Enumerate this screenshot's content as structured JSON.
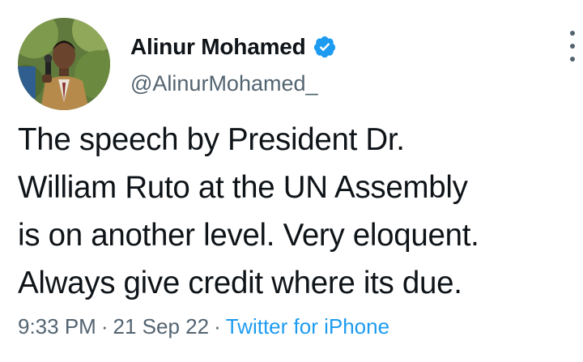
{
  "author": {
    "display_name": "Alinur Mohamed",
    "handle": "@AlinurMohamed_",
    "verified": true,
    "avatar_icon": "profile-photo"
  },
  "tweet": {
    "text_lines": [
      "The speech by President Dr.",
      "William Ruto at the UN Assembly",
      "is on another level. Very eloquent.",
      "Always give credit where its due."
    ]
  },
  "meta": {
    "time": "9:33 PM",
    "separator": "·",
    "date": "21 Sep 22",
    "source": "Twitter for iPhone"
  },
  "colors": {
    "text": "#0f1419",
    "secondary": "#536471",
    "link": "#1d9bf0",
    "verified_badge": "#1d9bf0"
  }
}
